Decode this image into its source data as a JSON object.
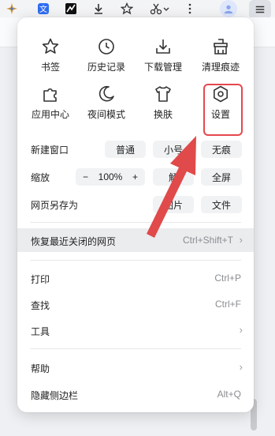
{
  "toolbar": {
    "icons": [
      "sparkle-icon",
      "translate-icon",
      "app-icon",
      "download-icon",
      "star-icon",
      "scissors-icon",
      "more-vertical-icon"
    ],
    "menu_icon": "hamburger-menu-icon"
  },
  "grid": [
    {
      "label": "书签",
      "icon": "star-icon"
    },
    {
      "label": "历史记录",
      "icon": "clock-icon"
    },
    {
      "label": "下载管理",
      "icon": "download-box-icon"
    },
    {
      "label": "清理痕迹",
      "icon": "broom-icon"
    },
    {
      "label": "应用中心",
      "icon": "puzzle-icon"
    },
    {
      "label": "夜间模式",
      "icon": "moon-icon"
    },
    {
      "label": "换肤",
      "icon": "tshirt-icon"
    },
    {
      "label": "设置",
      "icon": "gear-icon"
    }
  ],
  "new_window": {
    "label": "新建窗口",
    "options": [
      "普通",
      "小号",
      "无痕"
    ]
  },
  "zoom": {
    "label": "缩放",
    "minus": "−",
    "value": "100%",
    "plus": "+",
    "options": [
      "解",
      "全屏"
    ]
  },
  "save_as": {
    "label": "网页另存为",
    "options": [
      "图片",
      "文件"
    ]
  },
  "restore": {
    "label": "恢复最近关闭的网页",
    "shortcut": "Ctrl+Shift+T"
  },
  "print": {
    "label": "打印",
    "shortcut": "Ctrl+P"
  },
  "find": {
    "label": "查找",
    "shortcut": "Ctrl+F"
  },
  "tools": {
    "label": "工具"
  },
  "help": {
    "label": "帮助"
  },
  "hide_sidebar": {
    "label": "隐藏侧边栏",
    "shortcut": "Alt+Q"
  },
  "colors": {
    "accent_red": "#e5484d",
    "arrow_red": "#e04a4a"
  }
}
